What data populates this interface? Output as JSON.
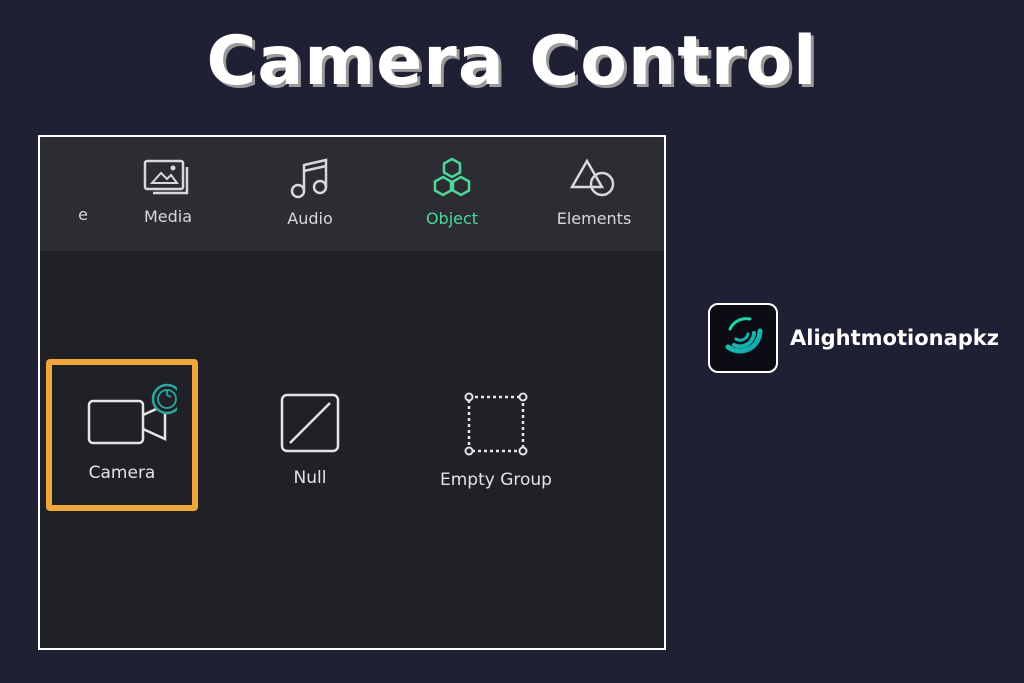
{
  "title": "Camera Control",
  "toolbar": {
    "partial_label": "e",
    "items": [
      {
        "label": "Media",
        "icon": "media-icon"
      },
      {
        "label": "Audio",
        "icon": "music-note-icon"
      },
      {
        "label": "Object",
        "icon": "hexagons-icon",
        "active": true
      },
      {
        "label": "Elements",
        "icon": "shapes-icon"
      }
    ]
  },
  "objects": [
    {
      "label": "Camera",
      "icon": "video-camera-icon",
      "selected": true
    },
    {
      "label": "Null",
      "icon": "null-icon"
    },
    {
      "label": "Empty Group",
      "icon": "empty-group-icon"
    }
  ],
  "brand": {
    "name": "Alightmotionapkz",
    "icon": "alight-motion-logo"
  },
  "colors": {
    "background": "#202034",
    "active_accent": "#4fd79b",
    "highlight": "#f0a73a",
    "panel": "#1f2127",
    "toolbar": "#2b2d33"
  }
}
